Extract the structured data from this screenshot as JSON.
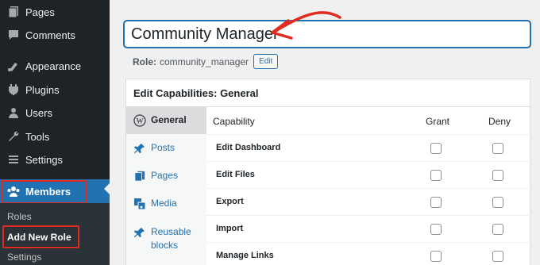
{
  "sidebar": {
    "items": [
      {
        "label": "Pages",
        "icon": "pages-icon"
      },
      {
        "label": "Comments",
        "icon": "comments-icon"
      },
      {
        "label": "Appearance",
        "icon": "appearance-icon"
      },
      {
        "label": "Plugins",
        "icon": "plugins-icon"
      },
      {
        "label": "Users",
        "icon": "users-icon"
      },
      {
        "label": "Tools",
        "icon": "tools-icon"
      },
      {
        "label": "Settings",
        "icon": "settings-icon"
      },
      {
        "label": "Members",
        "icon": "members-icon"
      }
    ],
    "submenu": [
      "Roles",
      "Add New Role",
      "Settings"
    ]
  },
  "editor": {
    "role_name_value": "Community Manager",
    "role_label": "Role:",
    "role_slug": "community_manager",
    "edit_button": "Edit"
  },
  "panel": {
    "title": "Edit Capabilities: General",
    "nav": [
      {
        "label": "General",
        "icon": "wordpress-icon"
      },
      {
        "label": "Posts",
        "icon": "pin-icon"
      },
      {
        "label": "Pages",
        "icon": "pages-icon"
      },
      {
        "label": "Media",
        "icon": "media-icon"
      },
      {
        "label": "Reusable blocks",
        "icon": "pin-icon"
      }
    ],
    "columns": [
      "Capability",
      "Grant",
      "Deny"
    ],
    "capabilities": [
      "Edit Dashboard",
      "Edit Files",
      "Export",
      "Import",
      "Manage Links"
    ]
  },
  "colors": {
    "accent": "#2271b1",
    "sidebar": "#1d2327",
    "highlight": "#e02b20"
  }
}
